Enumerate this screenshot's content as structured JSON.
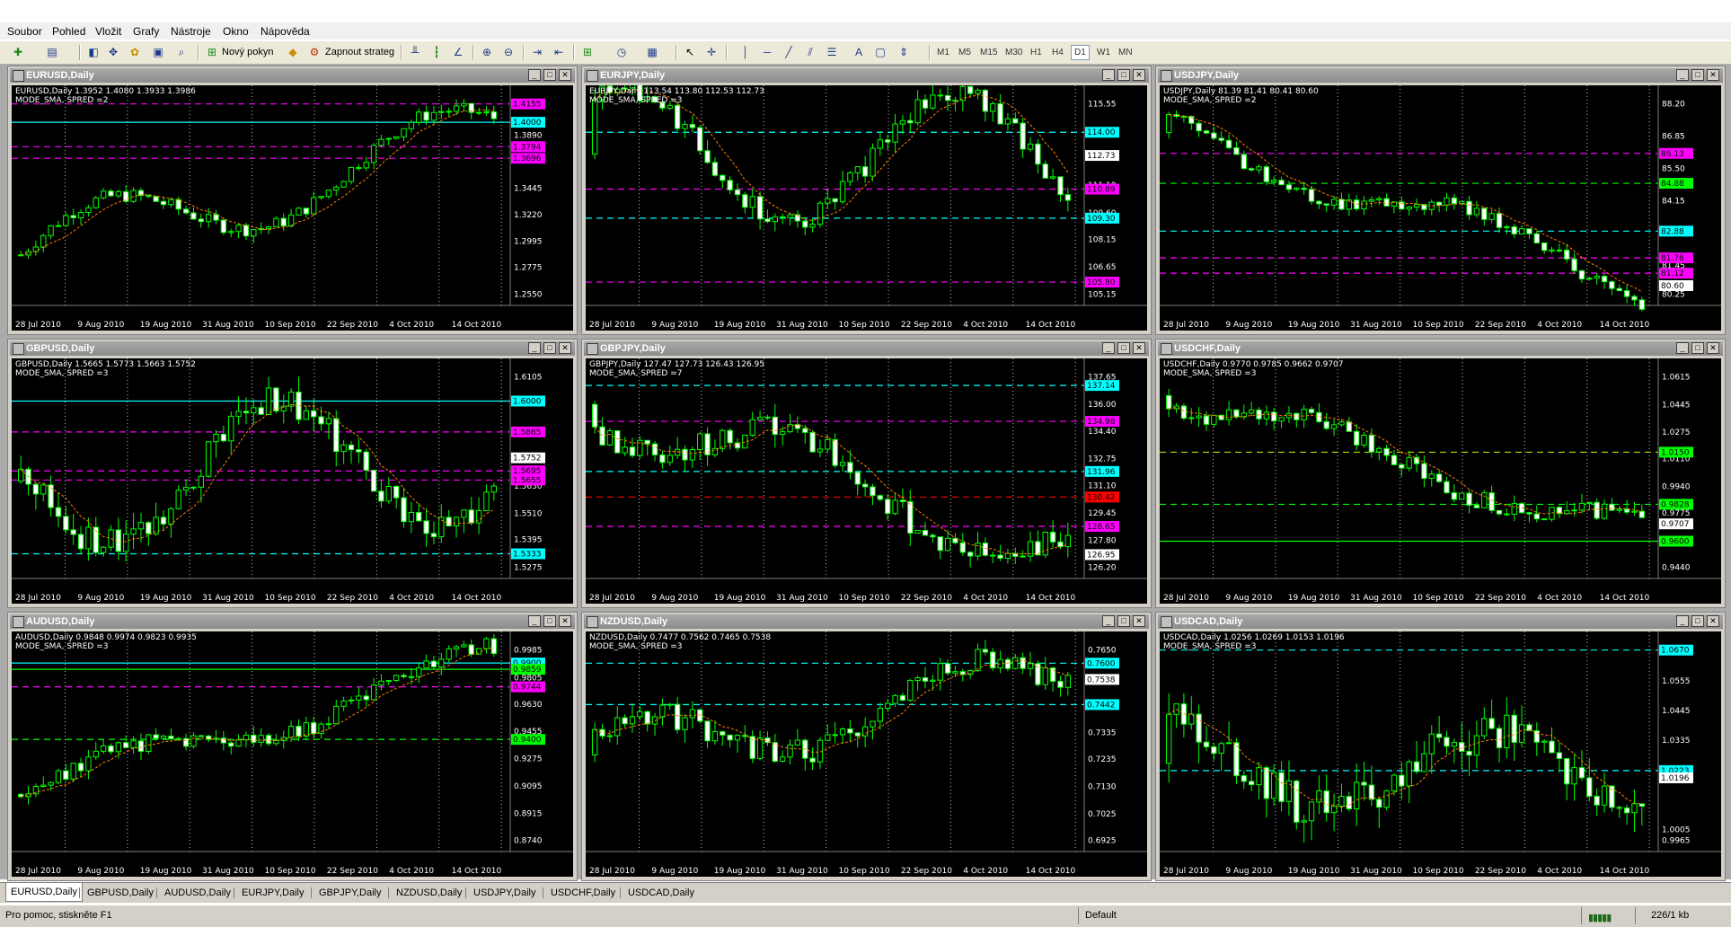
{
  "menu": [
    "Soubor",
    "Pohled",
    "Vložit",
    "Grafy",
    "Nástroje",
    "Okno",
    "Nápověda"
  ],
  "toolbar": {
    "new_order_label": "Nový pokyn",
    "autotrade_label": "Zapnout strateg",
    "timeframes": [
      "M1",
      "M5",
      "M15",
      "M30",
      "H1",
      "H4",
      "D1",
      "W1",
      "MN"
    ],
    "active_timeframe": "D1"
  },
  "x_labels": [
    "28 Jul 2010",
    "9 Aug 2010",
    "19 Aug 2010",
    "31 Aug 2010",
    "10 Sep 2010",
    "22 Sep 2010",
    "4 Oct 2010",
    "14 Oct 2010"
  ],
  "charts": [
    {
      "title": "EURUSD,Daily",
      "info1": "EURUSD,Daily  1.3952 1.4080 1.3933 1.3986",
      "info2": "MODE_SMA, SPRED =2",
      "ylabels": [
        "1.4155",
        "1.3890",
        "1.3445",
        "1.3220",
        "1.2995",
        "1.2775",
        "1.2550"
      ],
      "boxes": [
        {
          "text": "1.4155",
          "color": "#ff00ff"
        },
        {
          "text": "1.4000",
          "color": "#00ffff"
        },
        {
          "text": "1.3794",
          "color": "#ff00ff"
        },
        {
          "text": "1.3696",
          "color": "#ff00ff"
        }
      ],
      "start": 1.288,
      "trend": 0.105,
      "wave": 0.03,
      "vol": 0.006,
      "lines": [
        {
          "level": 1.4155,
          "color": "#ff00ff",
          "dash": true
        },
        {
          "level": 1.4,
          "color": "#00ffff",
          "dash": false
        },
        {
          "level": 1.3794,
          "color": "#ff00ff",
          "dash": true
        },
        {
          "level": 1.3696,
          "color": "#ff00ff",
          "dash": true
        }
      ]
    },
    {
      "title": "EURJPY,Daily",
      "info1": "EURJPY,Daily  113.54 113.80 112.53 112.73",
      "info2": "MODE_SMA, SPRED =3",
      "ylabels": [
        "115.55",
        "114.00",
        "112.73",
        "111.10",
        "109.60",
        "108.15",
        "106.65",
        "105.15"
      ],
      "boxes": [
        {
          "text": "114.00",
          "color": "#00ffff"
        },
        {
          "text": "112.73",
          "color": "#ffffff"
        },
        {
          "text": "110.89",
          "color": "#ff00ff"
        },
        {
          "text": "109.30",
          "color": "#00ffff"
        },
        {
          "text": "105.80",
          "color": "#ff00ff"
        }
      ],
      "start": 112.8,
      "trend": -0.3,
      "wave": 3.5,
      "vol": 0.6,
      "lines": [
        {
          "level": 114.0,
          "color": "#00ffff",
          "dash": true
        },
        {
          "level": 110.89,
          "color": "#ff00ff",
          "dash": true
        },
        {
          "level": 109.3,
          "color": "#00ffff",
          "dash": true
        },
        {
          "level": 105.8,
          "color": "#ff00ff",
          "dash": true
        }
      ]
    },
    {
      "title": "USDJPY,Daily",
      "info1": "USDJPY,Daily  81.39 81.41 80.41 80.60",
      "info2": "MODE_SMA, SPRED =2",
      "ylabels": [
        "88.20",
        "86.85",
        "85.50",
        "84.15",
        "82.80",
        "81.45",
        "80.25"
      ],
      "boxes": [
        {
          "text": "86.13",
          "color": "#ff00ff"
        },
        {
          "text": "84.88",
          "color": "#00ff00"
        },
        {
          "text": "82.88",
          "color": "#00ffff"
        },
        {
          "text": "81.76",
          "color": "#ff00ff"
        },
        {
          "text": "81.12",
          "color": "#ff00ff"
        },
        {
          "text": "80.60",
          "color": "#ffffff"
        }
      ],
      "start": 87.0,
      "trend": -6.4,
      "wave": 0.8,
      "vol": 0.3,
      "lines": [
        {
          "level": 86.13,
          "color": "#ff00ff",
          "dash": true
        },
        {
          "level": 84.88,
          "color": "#00ff00",
          "dash": true
        },
        {
          "level": 82.88,
          "color": "#00ffff",
          "dash": true
        },
        {
          "level": 81.76,
          "color": "#ff00ff",
          "dash": true
        },
        {
          "level": 81.12,
          "color": "#ff00ff",
          "dash": true
        }
      ]
    },
    {
      "title": "GBPUSD,Daily",
      "info1": "GBPUSD,Daily  1.5665 1.5773 1.5663 1.5752",
      "info2": "MODE_SMA, SPRED =3",
      "ylabels": [
        "1.6105",
        "1.5865",
        "1.5752",
        "1.5630",
        "1.5510",
        "1.5395",
        "1.5275"
      ],
      "boxes": [
        {
          "text": "1.6000",
          "color": "#00ffff"
        },
        {
          "text": "1.5865",
          "color": "#ff00ff"
        },
        {
          "text": "1.5752",
          "color": "#ffffff"
        },
        {
          "text": "1.5695",
          "color": "#ff00ff"
        },
        {
          "text": "1.5655",
          "color": "#ff00ff"
        },
        {
          "text": "1.5333",
          "color": "#00ffff"
        }
      ],
      "start": 1.565,
      "trend": 0.01,
      "wave": 0.03,
      "vol": 0.007,
      "lines": [
        {
          "level": 1.6,
          "color": "#00ffff",
          "dash": false
        },
        {
          "level": 1.5865,
          "color": "#ff00ff",
          "dash": true
        },
        {
          "level": 1.5695,
          "color": "#ff00ff",
          "dash": true
        },
        {
          "level": 1.5655,
          "color": "#ff00ff",
          "dash": true
        },
        {
          "level": 1.5333,
          "color": "#00ffff",
          "dash": true
        }
      ]
    },
    {
      "title": "GBPJPY,Daily",
      "info1": "GBPJPY,Daily  127.47 127.73 126.43 126.95",
      "info2": "MODE_SMA, SPRED =7",
      "ylabels": [
        "137.65",
        "136.00",
        "134.40",
        "132.75",
        "131.10",
        "129.45",
        "127.80",
        "126.20"
      ],
      "boxes": [
        {
          "text": "137.14",
          "color": "#00ffff"
        },
        {
          "text": "134.98",
          "color": "#ff00ff"
        },
        {
          "text": "131.96",
          "color": "#00ffff"
        },
        {
          "text": "130.42",
          "color": "#ff0000"
        },
        {
          "text": "128.65",
          "color": "#ff00ff"
        },
        {
          "text": "126.95",
          "color": "#ffffff"
        }
      ],
      "start": 136.0,
      "trend": -9.0,
      "wave": 2.0,
      "vol": 0.8,
      "lines": [
        {
          "level": 137.14,
          "color": "#00ffff",
          "dash": true
        },
        {
          "level": 134.98,
          "color": "#ff00ff",
          "dash": true
        },
        {
          "level": 131.96,
          "color": "#00ffff",
          "dash": true
        },
        {
          "level": 130.42,
          "color": "#ff0000",
          "dash": true
        },
        {
          "level": 128.65,
          "color": "#ff00ff",
          "dash": true
        }
      ]
    },
    {
      "title": "USDCHF,Daily",
      "info1": "USDCHF,Daily  0.9770 0.9785 0.9662 0.9707",
      "info2": "MODE_SMA, SPRED =3",
      "ylabels": [
        "1.0615",
        "1.0445",
        "1.0275",
        "1.0110",
        "0.9940",
        "0.9775",
        "0.9610",
        "0.9440"
      ],
      "boxes": [
        {
          "text": "1.0150",
          "color": "#00ff00"
        },
        {
          "text": "0.9828",
          "color": "#00ff00"
        },
        {
          "text": "0.9707",
          "color": "#ffffff"
        },
        {
          "text": "0.9600",
          "color": "#00ff00"
        }
      ],
      "start": 1.05,
      "trend": -0.085,
      "wave": 0.01,
      "vol": 0.006,
      "lines": [
        {
          "level": 1.015,
          "color": "#b0e000",
          "dash": true
        },
        {
          "level": 0.9828,
          "color": "#00ff00",
          "dash": true
        },
        {
          "level": 0.96,
          "color": "#00ff00",
          "dash": false
        }
      ]
    },
    {
      "title": "AUDUSD,Daily",
      "info1": "AUDUSD,Daily  0.9848 0.9974 0.9823 0.9935",
      "info2": "MODE_SMA, SPRED =3",
      "ylabels": [
        "0.9985",
        "0.9805",
        "0.9630",
        "0.9455",
        "0.9275",
        "0.9095",
        "0.8915",
        "0.8740"
      ],
      "boxes": [
        {
          "text": "0.9900",
          "color": "#00ffff"
        },
        {
          "text": "0.9859",
          "color": "#00ff00"
        },
        {
          "text": "0.9744",
          "color": "#ff00ff"
        },
        {
          "text": "0.9400",
          "color": "#00ff00"
        }
      ],
      "start": 0.904,
      "trend": 0.09,
      "wave": 0.012,
      "vol": 0.006,
      "lines": [
        {
          "level": 0.99,
          "color": "#00ffff",
          "dash": false
        },
        {
          "level": 0.9859,
          "color": "#00ff00",
          "dash": false
        },
        {
          "level": 0.9744,
          "color": "#ff00ff",
          "dash": true
        },
        {
          "level": 0.94,
          "color": "#00ff00",
          "dash": true
        }
      ]
    },
    {
      "title": "NZDUSD,Daily",
      "info1": "NZDUSD,Daily  0.7477 0.7562 0.7465 0.7538",
      "info2": "MODE_SMA, SPRED =3",
      "ylabels": [
        "0.7650",
        "0.7538",
        "0.7440",
        "0.7335",
        "0.7235",
        "0.7130",
        "0.7025",
        "0.6925"
      ],
      "boxes": [
        {
          "text": "0.7600",
          "color": "#00ffff"
        },
        {
          "text": "0.7538",
          "color": "#ffffff"
        },
        {
          "text": "0.7442",
          "color": "#00ffff"
        }
      ],
      "start": 0.725,
      "trend": 0.03,
      "wave": 0.012,
      "vol": 0.005,
      "lines": [
        {
          "level": 0.76,
          "color": "#00ffff",
          "dash": true
        },
        {
          "level": 0.7442,
          "color": "#00ffff",
          "dash": true
        }
      ]
    },
    {
      "title": "USDCAD,Daily",
      "info1": "USDCAD,Daily  1.0256 1.0269 1.0153 1.0196",
      "info2": "MODE_SMA, SPRED =3",
      "ylabels": [
        "1.0670",
        "1.0555",
        "1.0445",
        "1.0335",
        "1.0225",
        "1.0196",
        "1.0005",
        "0.9965"
      ],
      "boxes": [
        {
          "text": "1.0670",
          "color": "#00ffff"
        },
        {
          "text": "1.0223",
          "color": "#00ffff"
        },
        {
          "text": "1.0196",
          "color": "#ffffff"
        }
      ],
      "start": 1.025,
      "trend": -0.005,
      "wave": 0.015,
      "vol": 0.008,
      "lines": [
        {
          "level": 1.067,
          "color": "#00ffff",
          "dash": true
        },
        {
          "level": 1.0223,
          "color": "#00ffff",
          "dash": true
        }
      ]
    }
  ],
  "tabs": [
    "EURUSD,Daily",
    "GBPUSD,Daily",
    "AUDUSD,Daily",
    "EURJPY,Daily",
    "GBPJPY,Daily",
    "NZDUSD,Daily",
    "USDJPY,Daily",
    "USDCHF,Daily",
    "USDCAD,Daily"
  ],
  "status": {
    "help": "Pro pomoc, stiskněte F1",
    "profile": "Default",
    "traffic": "226/1 kb"
  }
}
